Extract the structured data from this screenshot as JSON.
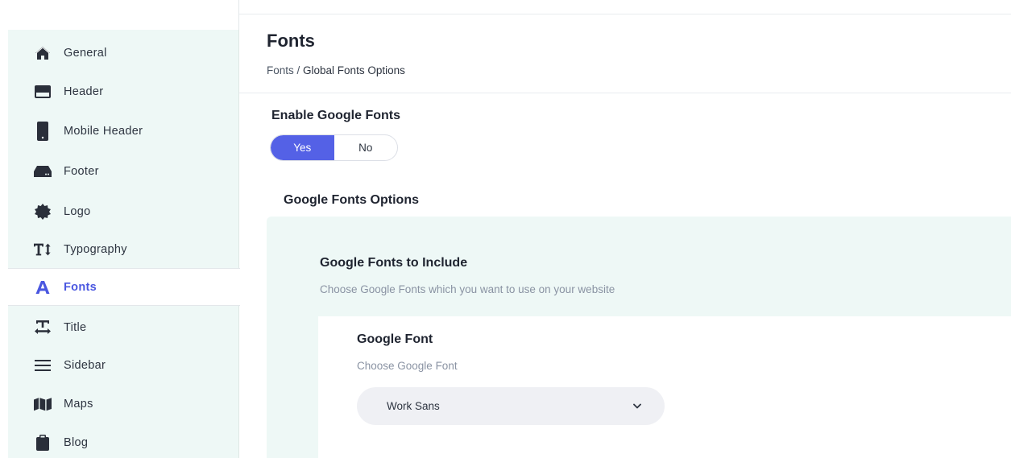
{
  "sidebar": {
    "items": [
      {
        "label": "General",
        "icon": "home-icon"
      },
      {
        "label": "Header",
        "icon": "header-icon"
      },
      {
        "label": "Mobile Header",
        "icon": "mobile-icon"
      },
      {
        "label": "Footer",
        "icon": "footer-icon"
      },
      {
        "label": "Logo",
        "icon": "badge-icon"
      },
      {
        "label": "Typography",
        "icon": "text-height-icon"
      },
      {
        "label": "Fonts",
        "icon": "font-icon",
        "active": true
      },
      {
        "label": "Title",
        "icon": "text-width-icon"
      },
      {
        "label": "Sidebar",
        "icon": "menu-lines-icon"
      },
      {
        "label": "Maps",
        "icon": "map-icon"
      },
      {
        "label": "Blog",
        "icon": "clipboard-icon"
      }
    ]
  },
  "page": {
    "title": "Fonts",
    "breadcrumb": {
      "link": "Fonts",
      "separator": " / ",
      "current": "Global Fonts Options"
    }
  },
  "enable_google_fonts": {
    "label": "Enable Google Fonts",
    "options": [
      "Yes",
      "No"
    ],
    "selected": "Yes"
  },
  "google_fonts_options": {
    "heading": "Google Fonts Options",
    "include_title": "Google Fonts to Include",
    "include_desc": "Choose Google Fonts which you want to use on your website",
    "font": {
      "title": "Google Font",
      "desc": "Choose Google Font",
      "selected_value": "Work Sans"
    }
  },
  "colors": {
    "accent": "#5461e6",
    "sidebar_bg": "#eef8f6",
    "active_text": "#4a57e0"
  }
}
